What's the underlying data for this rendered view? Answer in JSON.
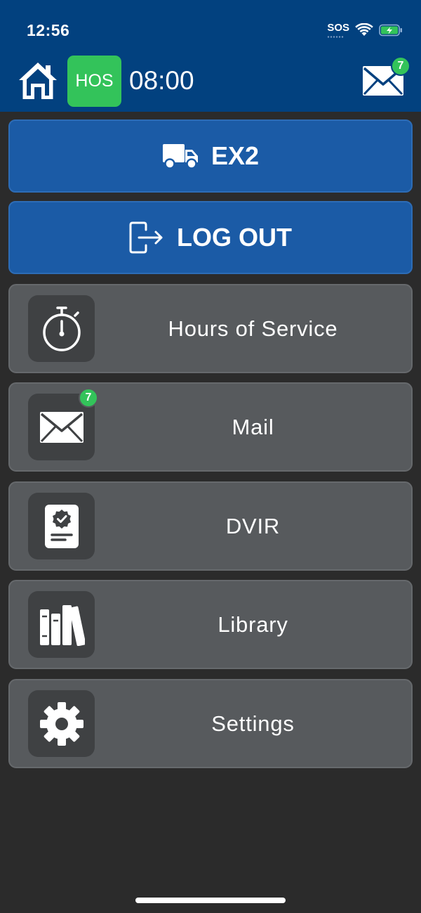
{
  "status_bar": {
    "time": "12:56",
    "sos": "SOS"
  },
  "header": {
    "hos_label": "HOS",
    "hos_time": "08:00",
    "mail_badge": "7"
  },
  "actions": {
    "vehicle_label": "EX2",
    "logout_label": "LOG OUT"
  },
  "menu": {
    "items": [
      {
        "label": "Hours of Service",
        "icon": "stopwatch-icon"
      },
      {
        "label": "Mail",
        "icon": "envelope-icon",
        "badge": "7"
      },
      {
        "label": "DVIR",
        "icon": "inspection-report-icon"
      },
      {
        "label": "Library",
        "icon": "books-icon"
      },
      {
        "label": "Settings",
        "icon": "gear-icon"
      }
    ]
  },
  "colors": {
    "header_bg": "#02417f",
    "accent_green": "#33c35a",
    "button_blue": "#1b5ba6",
    "menu_item_bg": "#575a5d",
    "background": "#2b2b2b"
  }
}
